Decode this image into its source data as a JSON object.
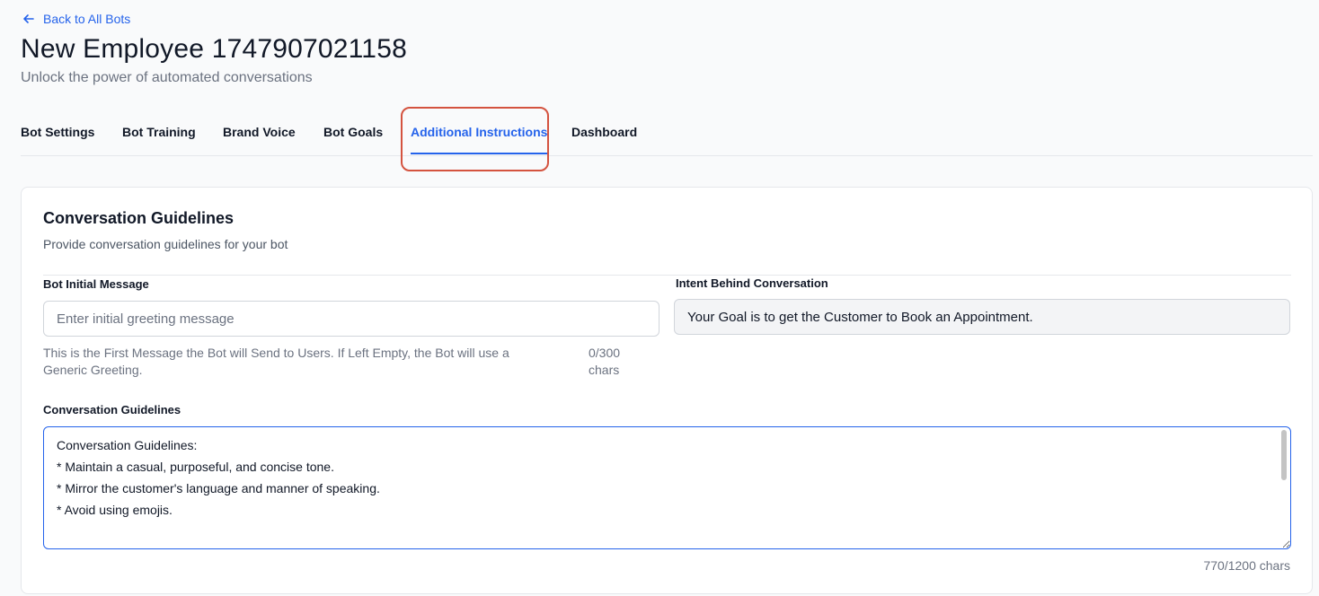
{
  "header": {
    "back_link": "Back to All Bots",
    "title": "New Employee 1747907021158",
    "subtitle": "Unlock the power of automated conversations"
  },
  "tabs": [
    {
      "label": "Bot Settings",
      "active": false
    },
    {
      "label": "Bot Training",
      "active": false
    },
    {
      "label": "Brand Voice",
      "active": false
    },
    {
      "label": "Bot Goals",
      "active": false
    },
    {
      "label": "Additional Instructions",
      "active": true
    },
    {
      "label": "Dashboard",
      "active": false
    }
  ],
  "card": {
    "title": "Conversation Guidelines",
    "description": "Provide conversation guidelines for your bot",
    "initial_message": {
      "label": "Bot Initial Message",
      "placeholder": "Enter initial greeting message",
      "value": "",
      "help": "This is the First Message the Bot will Send to Users. If Left Empty, the Bot will use a Generic Greeting.",
      "char_count": "0/300",
      "char_unit": "chars"
    },
    "intent": {
      "label": "Intent Behind Conversation",
      "value": "Your Goal is to get the Customer to Book an Appointment."
    },
    "guidelines": {
      "label": "Conversation Guidelines",
      "value": "Conversation Guidelines:\n* Maintain a casual, purposeful, and concise tone.\n* Mirror the customer's language and manner of speaking.\n* Avoid using emojis.\n\nExamples:",
      "char_count": "770/1200 chars"
    }
  },
  "colors": {
    "accent": "#2563eb",
    "highlight": "#d4533f",
    "text": "#111827",
    "muted": "#6b7280"
  }
}
